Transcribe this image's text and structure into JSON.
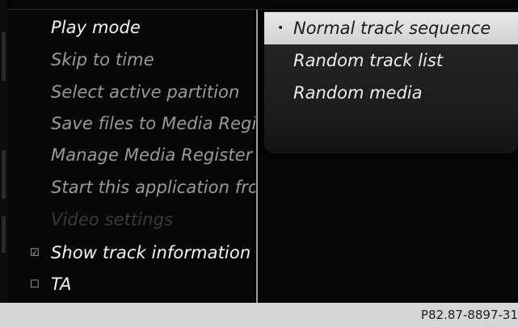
{
  "menu": {
    "items": [
      {
        "label": "Play mode",
        "state": "active",
        "check": ""
      },
      {
        "label": "Skip to time",
        "state": "inactive",
        "check": ""
      },
      {
        "label": "Select active partition",
        "state": "inactive",
        "check": ""
      },
      {
        "label": "Save files to Media Register",
        "state": "inactive",
        "check": ""
      },
      {
        "label": "Manage Media Register",
        "state": "inactive",
        "check": ""
      },
      {
        "label": "Start this application from",
        "state": "inactive",
        "check": ""
      },
      {
        "label": "Video settings",
        "state": "disabled",
        "check": ""
      },
      {
        "label": "Show track information",
        "state": "active",
        "check": "☑"
      },
      {
        "label": "TA",
        "state": "active",
        "check": "☐"
      }
    ]
  },
  "play_mode_options": {
    "items": [
      {
        "label": "Normal track sequence",
        "selected": true,
        "marker": "•"
      },
      {
        "label": "Random track list",
        "selected": false,
        "marker": ""
      },
      {
        "label": "Random media",
        "selected": false,
        "marker": ""
      }
    ]
  },
  "caption": "P82.87-8897-31"
}
